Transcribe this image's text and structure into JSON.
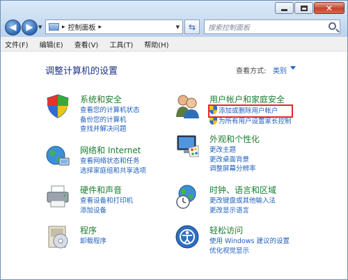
{
  "window": {
    "close_glyph": "✕"
  },
  "nav": {
    "back_glyph": "◀",
    "forward_glyph": "▶",
    "dropdown_glyph": "▼",
    "refresh_glyph": "⇆"
  },
  "address": {
    "separator": "▸",
    "path": "控制面板",
    "trailing_separator": "▸"
  },
  "search": {
    "placeholder": "搜索控制面板"
  },
  "menu": [
    {
      "label": "文件(F)"
    },
    {
      "label": "编辑(E)"
    },
    {
      "label": "查看(V)"
    },
    {
      "label": "工具(T)"
    },
    {
      "label": "帮助(H)"
    }
  ],
  "page": {
    "title": "调整计算机的设置",
    "view_label": "查看方式:",
    "view_value": "类别"
  },
  "categories": {
    "system": {
      "heading": "系统和安全",
      "icon": "shield-icon",
      "links": [
        "查看您的计算机状态",
        "备份您的计算机",
        "查找并解决问题"
      ]
    },
    "network": {
      "heading": "网络和 Internet",
      "icon": "network-globe-icon",
      "links": [
        "查看网络状态和任务",
        "选择家庭组和共享选项"
      ]
    },
    "hardware": {
      "heading": "硬件和声音",
      "icon": "printer-icon",
      "links": [
        "查看设备和打印机",
        "添加设备"
      ]
    },
    "programs": {
      "heading": "程序",
      "icon": "programs-disc-icon",
      "links": [
        "卸载程序"
      ]
    },
    "users": {
      "heading": "用户帐户和家庭安全",
      "icon": "users-icon",
      "links": [
        "添加或删除用户帐户",
        "为所有用户设置家长控制"
      ]
    },
    "appearance": {
      "heading": "外观和个性化",
      "icon": "monitor-palette-icon",
      "links": [
        "更改主题",
        "更改桌面背景",
        "调整屏幕分辨率"
      ]
    },
    "clock": {
      "heading": "时钟、语言和区域",
      "icon": "clock-globe-icon",
      "links": [
        "更改键盘或其他输入法",
        "更改显示语言"
      ]
    },
    "access": {
      "heading": "轻松访问",
      "icon": "ease-of-access-icon",
      "links": [
        "使用 Windows 建议的设置",
        "优化视觉显示"
      ]
    }
  },
  "colors": {
    "heading_green": "#1a7d2f",
    "link_blue": "#1f5fbd",
    "title_blue": "#1e3287",
    "highlight_red": "#e1262b"
  }
}
